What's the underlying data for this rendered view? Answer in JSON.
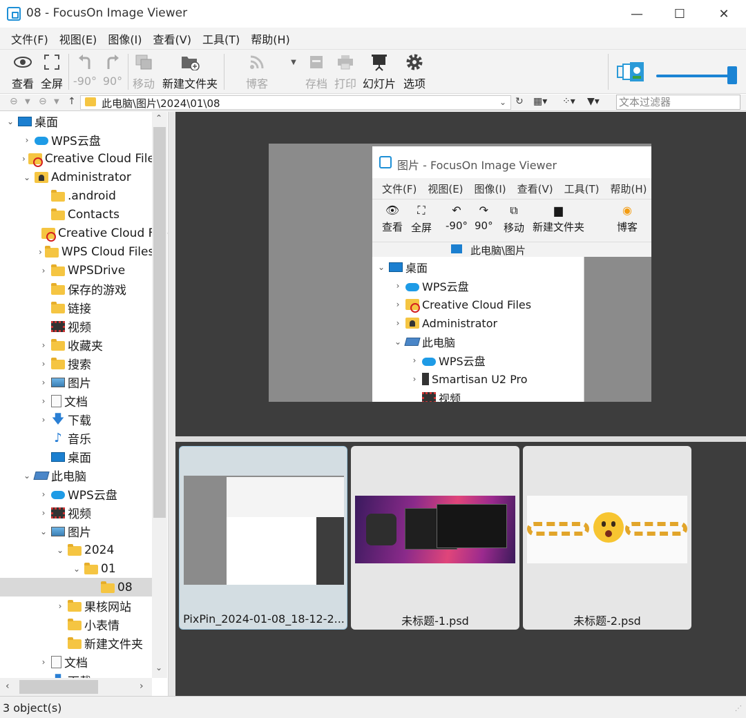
{
  "window": {
    "title": "08 - FocusOn Image Viewer",
    "minimize": "—",
    "maximize": "☐",
    "close": "✕"
  },
  "menu": [
    "文件(F)",
    "视图(E)",
    "图像(I)",
    "查看(V)",
    "工具(T)",
    "帮助(H)"
  ],
  "toolbar": {
    "view": "查看",
    "fullscreen": "全屏",
    "rot_left": "-90°",
    "rot_right": "90°",
    "move": "移动",
    "new_folder": "新建文件夹",
    "blog": "博客",
    "archive": "存档",
    "print": "打印",
    "slideshow": "幻灯片",
    "options": "选项"
  },
  "address": {
    "path": "此电脑\\图片\\2024\\01\\08",
    "filter_placeholder": "文本过滤器"
  },
  "tree": [
    {
      "label": "桌面",
      "level": 0,
      "expand": "open",
      "icon": "desktop-icon"
    },
    {
      "label": "WPS云盘",
      "level": 1,
      "expand": "closed",
      "icon": "cloud-icon"
    },
    {
      "label": "Creative Cloud Files",
      "level": 1,
      "expand": "closed",
      "icon": "creative-cloud-folder-icon"
    },
    {
      "label": "Administrator",
      "level": 1,
      "expand": "open",
      "icon": "user-folder-icon"
    },
    {
      "label": ".android",
      "level": 2,
      "expand": "none",
      "icon": "folder-icon"
    },
    {
      "label": "Contacts",
      "level": 2,
      "expand": "none",
      "icon": "folder-icon"
    },
    {
      "label": "Creative Cloud Files",
      "level": 2,
      "expand": "none",
      "icon": "creative-cloud-folder-icon"
    },
    {
      "label": "WPS Cloud Files",
      "level": 2,
      "expand": "closed",
      "icon": "folder-icon"
    },
    {
      "label": "WPSDrive",
      "level": 2,
      "expand": "closed",
      "icon": "folder-icon"
    },
    {
      "label": "保存的游戏",
      "level": 2,
      "expand": "none",
      "icon": "folder-icon"
    },
    {
      "label": "链接",
      "level": 2,
      "expand": "none",
      "icon": "folder-icon"
    },
    {
      "label": "视频",
      "level": 2,
      "expand": "none",
      "icon": "video-icon"
    },
    {
      "label": "收藏夹",
      "level": 2,
      "expand": "closed",
      "icon": "folder-icon"
    },
    {
      "label": "搜索",
      "level": 2,
      "expand": "closed",
      "icon": "folder-icon"
    },
    {
      "label": "图片",
      "level": 2,
      "expand": "closed",
      "icon": "image-icon"
    },
    {
      "label": "文档",
      "level": 2,
      "expand": "closed",
      "icon": "document-icon"
    },
    {
      "label": "下载",
      "level": 2,
      "expand": "closed",
      "icon": "download-icon"
    },
    {
      "label": "音乐",
      "level": 2,
      "expand": "none",
      "icon": "music-icon"
    },
    {
      "label": "桌面",
      "level": 2,
      "expand": "none",
      "icon": "desktop-icon"
    },
    {
      "label": "此电脑",
      "level": 1,
      "expand": "open",
      "icon": "computer-icon"
    },
    {
      "label": "WPS云盘",
      "level": 2,
      "expand": "closed",
      "icon": "cloud-icon"
    },
    {
      "label": "视频",
      "level": 2,
      "expand": "closed",
      "icon": "video-icon"
    },
    {
      "label": "图片",
      "level": 2,
      "expand": "open",
      "icon": "image-icon"
    },
    {
      "label": "2024",
      "level": 3,
      "expand": "open",
      "icon": "folder-icon"
    },
    {
      "label": "01",
      "level": 4,
      "expand": "open",
      "icon": "folder-icon"
    },
    {
      "label": "08",
      "level": 5,
      "expand": "none",
      "icon": "folder-icon",
      "selected": true
    },
    {
      "label": "果核网站",
      "level": 3,
      "expand": "closed",
      "icon": "folder-icon"
    },
    {
      "label": "小表情",
      "level": 3,
      "expand": "none",
      "icon": "folder-icon"
    },
    {
      "label": "新建文件夹",
      "level": 3,
      "expand": "none",
      "icon": "folder-icon"
    },
    {
      "label": "文档",
      "level": 2,
      "expand": "closed",
      "icon": "document-icon"
    },
    {
      "label": "下载",
      "level": 2,
      "expand": "closed",
      "icon": "download-icon"
    }
  ],
  "preview": {
    "title": "图片 - FocusOn Image Viewer",
    "menu": [
      "文件(F)",
      "视图(E)",
      "图像(I)",
      "查看(V)",
      "工具(T)",
      "帮助(H)"
    ],
    "toolbar": [
      "查看",
      "全屏",
      "-90°",
      "90°",
      "移动",
      "新建文件夹",
      "博客"
    ],
    "path": "此电脑\\图片",
    "tree": [
      "桌面",
      "WPS云盘",
      "Creative Cloud Files",
      "Administrator",
      "此电脑",
      "WPS云盘",
      "Smartisan U2 Pro",
      "视频"
    ]
  },
  "thumbnails": [
    {
      "name": "PixPin_2024-01-08_18-12-2...",
      "selected": true
    },
    {
      "name": "未标题-1.psd",
      "selected": false
    },
    {
      "name": "未标题-2.psd",
      "selected": false
    }
  ],
  "status": "3 object(s)",
  "colors": {
    "accent": "#1b84d4",
    "panel_bg": "#3d3d3d",
    "folder": "#f5c542"
  }
}
